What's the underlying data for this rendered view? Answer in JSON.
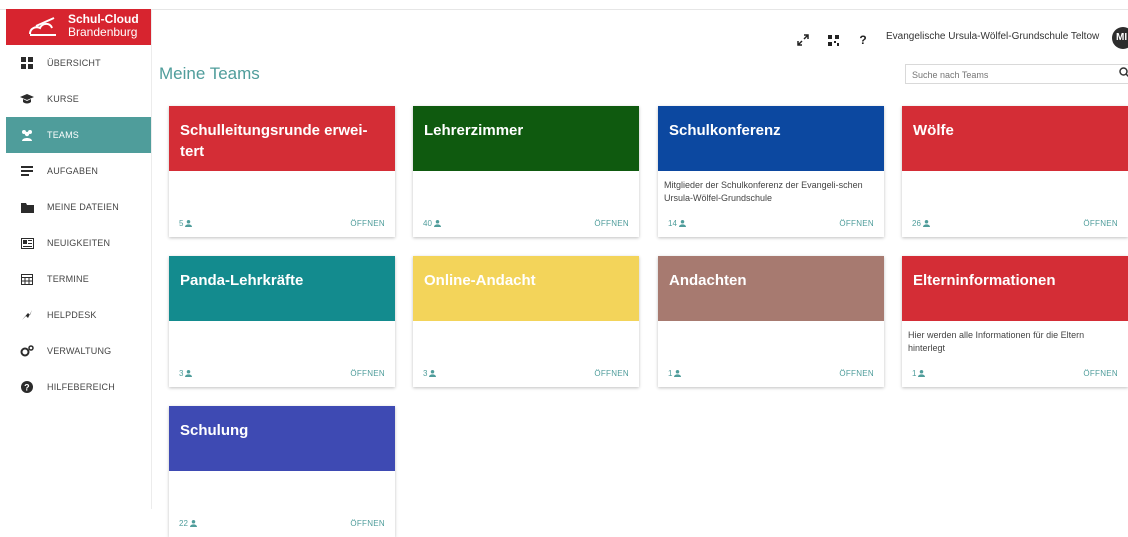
{
  "brand": {
    "line1": "Schul-Cloud",
    "line2": "Brandenburg",
    "color": "#d7242f"
  },
  "sidebar": {
    "items": [
      {
        "label": "ÜBERSICHT",
        "icon": "dashboard-icon"
      },
      {
        "label": "KURSE",
        "icon": "graduation-cap-icon"
      },
      {
        "label": "TEAMS",
        "icon": "users-icon",
        "active": true
      },
      {
        "label": "AUFGABEN",
        "icon": "tasks-icon"
      },
      {
        "label": "MEINE DATEIEN",
        "icon": "folder-icon"
      },
      {
        "label": "NEUIGKEITEN",
        "icon": "newspaper-icon"
      },
      {
        "label": "TERMINE",
        "icon": "calendar-icon"
      },
      {
        "label": "HELPDESK",
        "icon": "helpdesk-icon"
      },
      {
        "label": "VERWALTUNG",
        "icon": "cogs-icon"
      },
      {
        "label": "HILFEBEREICH",
        "icon": "question-circle-icon"
      }
    ],
    "active_color": "#4f9d9b"
  },
  "header": {
    "school": "Evangelische Ursula-Wölfel-Grundschule Teltow",
    "avatar": "MI",
    "help_glyph": "?"
  },
  "main": {
    "title": "Meine Teams",
    "search_placeholder": "Suche nach Teams"
  },
  "teams": [
    {
      "name": "Schulleitungsrunde erwei-tert",
      "desc": "",
      "members": "5",
      "color": "#d42d36",
      "open": "ÖFFNEN"
    },
    {
      "name": "Lehrerzimmer",
      "desc": "",
      "members": "40",
      "color": "#0f5a0f",
      "open": "ÖFFNEN"
    },
    {
      "name": "Schulkonferenz",
      "desc": "Mitglieder der Schulkonferenz der Evangeli-schen Ursula-Wölfel-Grundschule",
      "members": "14",
      "color": "#0c48a0",
      "open": "ÖFFNEN"
    },
    {
      "name": "Wölfe",
      "desc": "",
      "members": "26",
      "color": "#d42d36",
      "open": "ÖFFNEN"
    },
    {
      "name": "Panda-Lehrkräfte",
      "desc": "",
      "members": "3",
      "color": "#138b8e",
      "open": "ÖFFNEN"
    },
    {
      "name": "Online-Andacht",
      "desc": "",
      "members": "3",
      "color": "#f3d45a",
      "open": "ÖFFNEN"
    },
    {
      "name": "Andachten",
      "desc": "",
      "members": "1",
      "color": "#a77a70",
      "open": "ÖFFNEN"
    },
    {
      "name": "Elterninformationen",
      "desc": "Hier werden alle Informationen für die Eltern hinterlegt",
      "members": "1",
      "color": "#d42d36",
      "open": "ÖFFNEN"
    },
    {
      "name": "Schulung",
      "desc": "",
      "members": "22",
      "color": "#3e4ab3",
      "open": "ÖFFNEN"
    }
  ]
}
